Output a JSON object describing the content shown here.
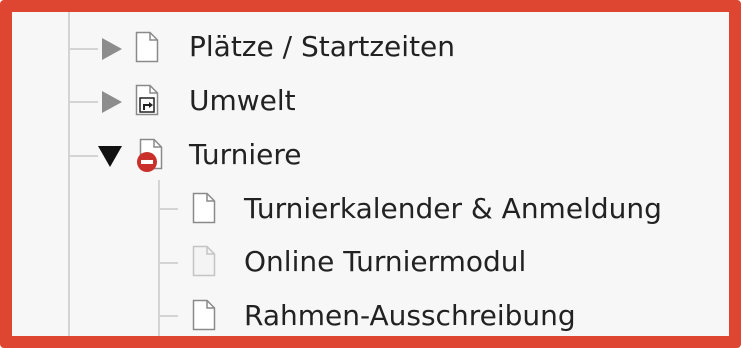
{
  "frame": {
    "border_color": "#df4631"
  },
  "tree": {
    "items": [
      {
        "label": "Plätze / Startzeiten",
        "toggle_icon": "triangle-right-icon",
        "page_icon": "page-icon",
        "state": "collapsed"
      },
      {
        "label": "Umwelt",
        "toggle_icon": "triangle-right-icon",
        "page_icon": "page-shortcut-icon",
        "state": "collapsed"
      },
      {
        "label": "Turniere",
        "toggle_icon": "triangle-down-icon",
        "page_icon": "page-hidden-icon",
        "state": "expanded"
      },
      {
        "label": "Turnierkalender & Anmeldung",
        "page_icon": "page-icon"
      },
      {
        "label": "Online Turniermodul",
        "page_icon": "page-disabled-icon"
      },
      {
        "label": "Rahmen-Ausschreibung",
        "page_icon": "page-icon"
      }
    ]
  }
}
